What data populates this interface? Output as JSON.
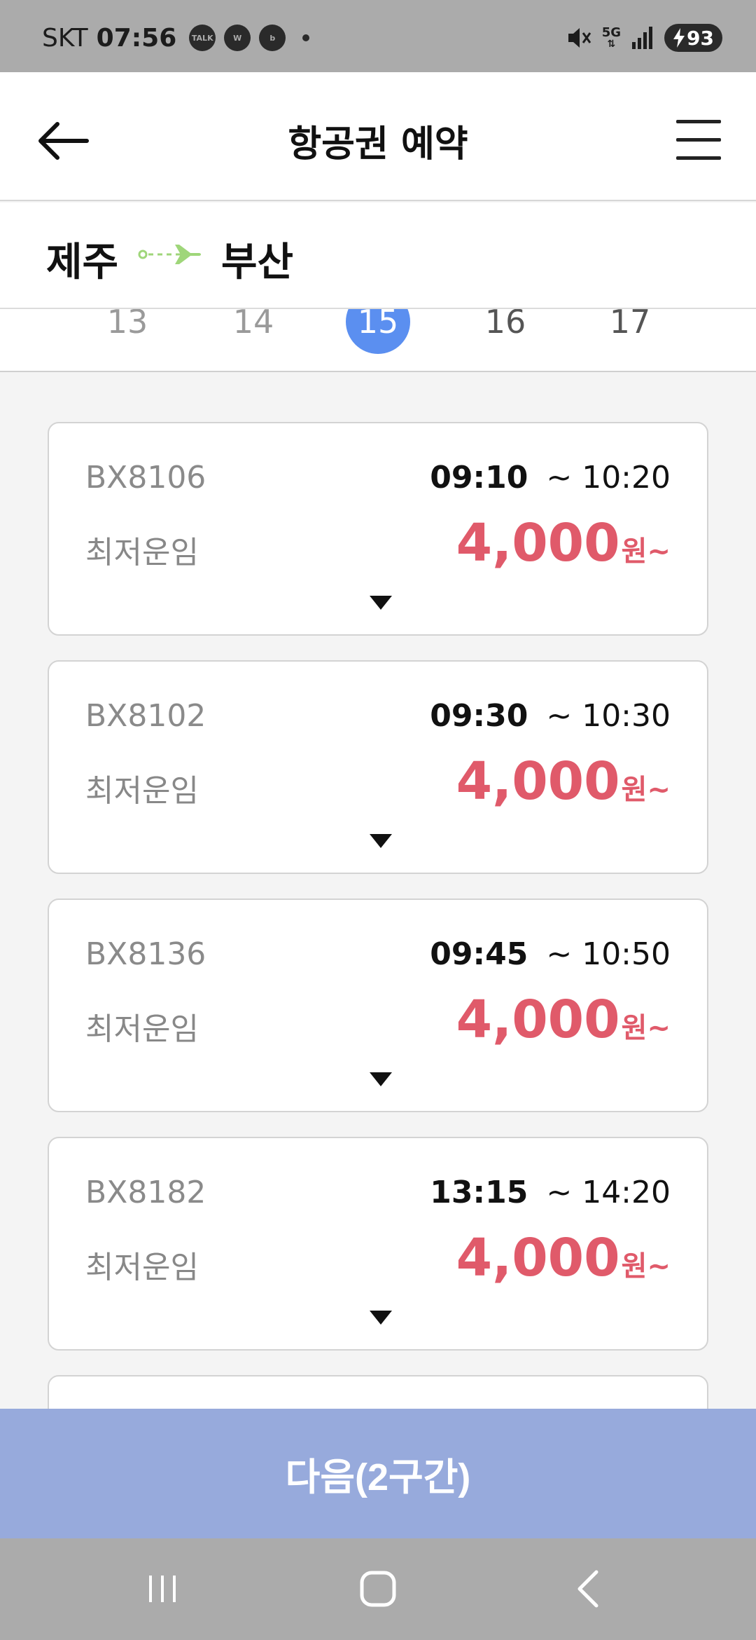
{
  "status_bar": {
    "carrier": "SKT",
    "time": "07:56",
    "notif_icons": [
      {
        "name": "kakaotalk-icon",
        "text": "TALK"
      },
      {
        "name": "app-w-icon",
        "text": "W"
      },
      {
        "name": "app-b-icon",
        "text": "b"
      }
    ],
    "network": "5G",
    "battery": "93"
  },
  "header": {
    "title": "항공권 예약"
  },
  "route": {
    "origin": "제주",
    "destination": "부산"
  },
  "dates": [
    {
      "day": "13"
    },
    {
      "day": "14"
    },
    {
      "day": "15"
    },
    {
      "day": "16"
    },
    {
      "day": "17"
    }
  ],
  "selected_date": "15",
  "flights": [
    {
      "number": "BX8106",
      "departure": "09:10",
      "arrival": "~ 10:20",
      "fare_label": "최저운임",
      "price": "4,000",
      "unit": "원~"
    },
    {
      "number": "BX8102",
      "departure": "09:30",
      "arrival": "~ 10:30",
      "fare_label": "최저운임",
      "price": "4,000",
      "unit": "원~"
    },
    {
      "number": "BX8136",
      "departure": "09:45",
      "arrival": "~ 10:50",
      "fare_label": "최저운임",
      "price": "4,000",
      "unit": "원~"
    },
    {
      "number": "BX8182",
      "departure": "13:15",
      "arrival": "~ 14:20",
      "fare_label": "최저운임",
      "price": "4,000",
      "unit": "원~"
    }
  ],
  "next_button": {
    "label": "다음(2구간)"
  },
  "colors": {
    "price": "#e05a6a",
    "selected_date": "#5b8ff0",
    "next_button": "#97aadc",
    "route_arrow": "#9fd67a"
  }
}
